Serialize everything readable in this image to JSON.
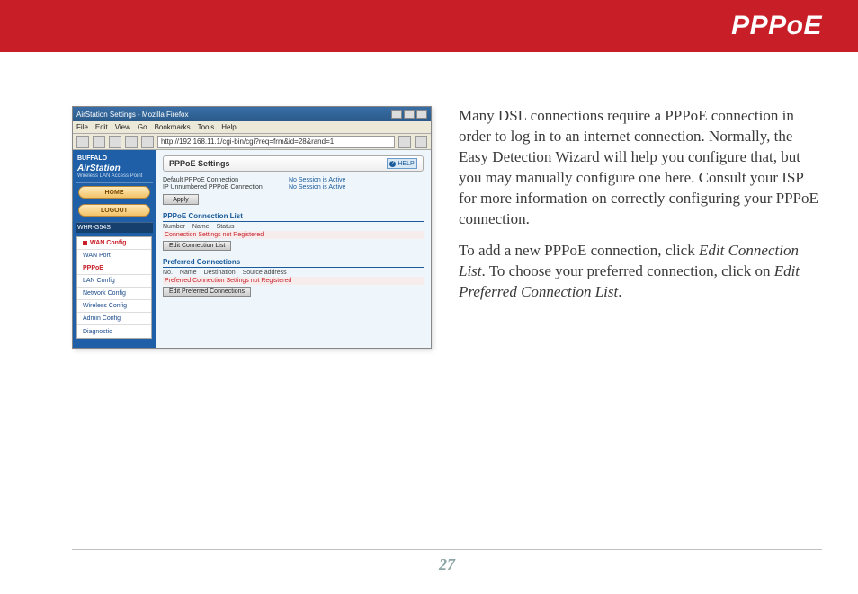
{
  "header": {
    "title": "PPPoE"
  },
  "browser": {
    "window_title": "AirStation Settings - Mozilla Firefox",
    "menu": [
      "File",
      "Edit",
      "View",
      "Go",
      "Bookmarks",
      "Tools",
      "Help"
    ],
    "url": "http://192.168.11.1/cgi-bin/cgi?req=frm&id=28&rand=1"
  },
  "sidebar": {
    "brand": "BUFFALO",
    "product": "AirStation",
    "product_sub": "Wireless LAN Access Point",
    "home_btn": "HOME",
    "logout_btn": "LOGOUT",
    "model": "WHR-G54S",
    "nav": [
      {
        "label": "WAN Config",
        "active": true
      },
      {
        "label": "WAN Port"
      },
      {
        "label": "PPPoE",
        "highlight": true
      },
      {
        "label": "LAN Config"
      },
      {
        "label": "Network Config"
      },
      {
        "label": "Wireless Config"
      },
      {
        "label": "Admin Config"
      },
      {
        "label": "Diagnostic"
      }
    ]
  },
  "panel": {
    "title": "PPPoE Settings",
    "help": "HELP",
    "status": [
      {
        "label": "Default PPPoE Connection",
        "value": "No Session is Active"
      },
      {
        "label": "IP Unnumbered PPPoE Connection",
        "value": "No Session is Active"
      }
    ],
    "apply": "Apply",
    "conn_list_title": "PPPoE Connection List",
    "conn_headers": [
      "Number",
      "Name",
      "Status"
    ],
    "conn_msg": "Connection Settings not Registered",
    "edit_conn_btn": "Edit Connection List",
    "pref_title": "Preferred Connections",
    "pref_headers": [
      "No.",
      "Name",
      "Destination",
      "Source address"
    ],
    "pref_msg": "Preferred Connection Settings not Registered",
    "edit_pref_btn": "Edit Preferred Connections"
  },
  "doc": {
    "p1": "Many DSL connections require a PPPoE connection in order to log in to an internet connection.  Normally, the Easy Detection Wizard will help you configure that, but you may manually configure one here.  Consult your ISP for more information on correctly configuring your PPPoE connection.",
    "p2a": "To add a new PPPoE connection, click ",
    "p2i1": "Edit Connection List",
    "p2b": ".  To choose your preferred connection, click on ",
    "p2i2": "Edit Preferred Connection List",
    "p2c": "."
  },
  "page_number": "27"
}
